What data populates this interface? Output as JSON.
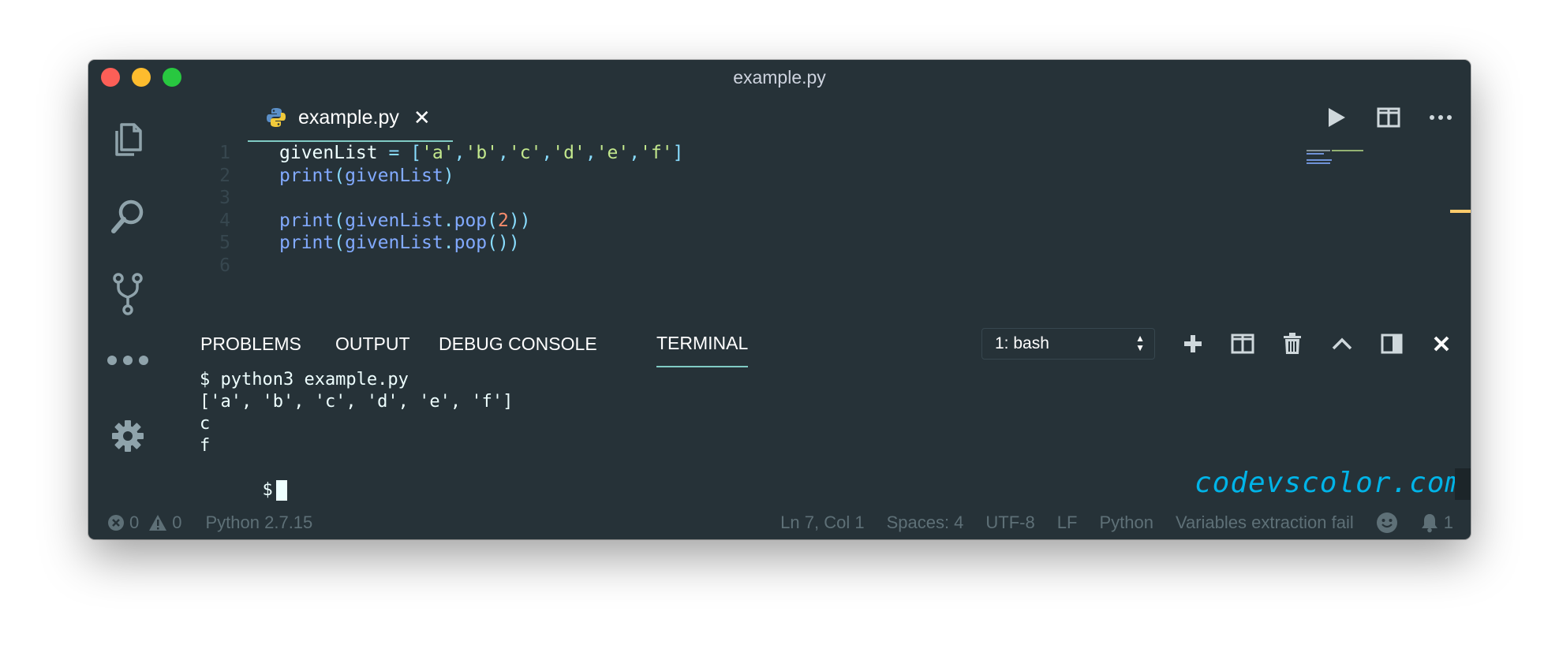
{
  "window": {
    "title": "example.py"
  },
  "activity_bar": {
    "items": [
      {
        "icon": "files-icon"
      },
      {
        "icon": "search-icon"
      },
      {
        "icon": "source-control-icon"
      },
      {
        "icon": "more-icon"
      },
      {
        "icon": "gear-icon"
      }
    ]
  },
  "tab": {
    "label": "example.py",
    "close": "✕",
    "icon": "python-icon"
  },
  "editor_actions": [
    "run-icon",
    "split-editor-icon",
    "more-actions-icon"
  ],
  "editor": {
    "line_numbers": [
      "1",
      "2",
      "3",
      "4",
      "5",
      "6"
    ],
    "lines": [
      [
        {
          "t": "givenList ",
          "c": "var"
        },
        {
          "t": "=",
          "c": "op"
        },
        {
          "t": " ",
          "c": "var"
        },
        {
          "t": "[",
          "c": "op"
        },
        {
          "t": "'a'",
          "c": "str"
        },
        {
          "t": ",",
          "c": "op"
        },
        {
          "t": "'b'",
          "c": "str"
        },
        {
          "t": ",",
          "c": "op"
        },
        {
          "t": "'c'",
          "c": "str"
        },
        {
          "t": ",",
          "c": "op"
        },
        {
          "t": "'d'",
          "c": "str"
        },
        {
          "t": ",",
          "c": "op"
        },
        {
          "t": "'e'",
          "c": "str"
        },
        {
          "t": ",",
          "c": "op"
        },
        {
          "t": "'f'",
          "c": "str"
        },
        {
          "t": "]",
          "c": "op"
        }
      ],
      [
        {
          "t": "print",
          "c": "fn"
        },
        {
          "t": "(",
          "c": "op"
        },
        {
          "t": "givenList",
          "c": "fn"
        },
        {
          "t": ")",
          "c": "op"
        }
      ],
      [],
      [
        {
          "t": "print",
          "c": "fn"
        },
        {
          "t": "(",
          "c": "op"
        },
        {
          "t": "givenList",
          "c": "fn"
        },
        {
          "t": ".",
          "c": "op"
        },
        {
          "t": "pop",
          "c": "fn"
        },
        {
          "t": "(",
          "c": "op"
        },
        {
          "t": "2",
          "c": "num"
        },
        {
          "t": "))",
          "c": "op"
        }
      ],
      [
        {
          "t": "print",
          "c": "fn"
        },
        {
          "t": "(",
          "c": "op"
        },
        {
          "t": "givenList",
          "c": "fn"
        },
        {
          "t": ".",
          "c": "op"
        },
        {
          "t": "pop",
          "c": "fn"
        },
        {
          "t": "())",
          "c": "op"
        }
      ],
      []
    ]
  },
  "panel": {
    "tabs": [
      "PROBLEMS",
      "OUTPUT",
      "DEBUG CONSOLE",
      "TERMINAL"
    ],
    "active_tab": "TERMINAL",
    "terminal_select": "1: bash",
    "actions": [
      "add-icon",
      "split-terminal-icon",
      "trash-icon",
      "chevron-up-icon",
      "toggle-panel-icon",
      "close-icon"
    ]
  },
  "terminal": {
    "lines": [
      "$ python3 example.py",
      "['a', 'b', 'c', 'd', 'e', 'f']",
      "c",
      "f"
    ],
    "prompt": "$"
  },
  "watermark": "codevscolor.com",
  "statusbar": {
    "errors": "0",
    "warnings": "0",
    "interpreter": "Python 2.7.15",
    "position": "Ln 7, Col 1",
    "spaces": "Spaces: 4",
    "encoding": "UTF-8",
    "eol": "LF",
    "language": "Python",
    "message": "Variables extraction fail",
    "notifications": "1"
  },
  "colors": {
    "background": "#263238",
    "accent": "#80cbc4",
    "string": "#c3e88d",
    "function": "#82aaff",
    "operator": "#89ddff",
    "number": "#f78c6c",
    "watermark": "#00b4e8"
  }
}
